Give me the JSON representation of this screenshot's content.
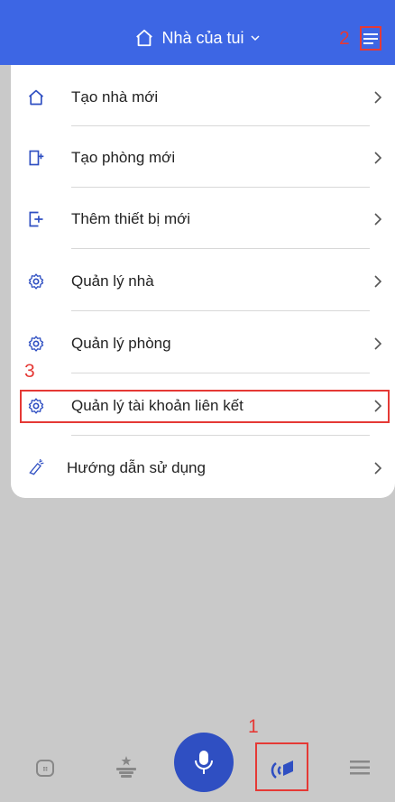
{
  "header": {
    "title": "Nhà của tui",
    "home_icon": "home-outline-icon",
    "dropdown_icon": "chevron-down-icon",
    "menu_icon": "hamburger-menu-icon",
    "color": "#3d66e4"
  },
  "menu": {
    "items": [
      {
        "label": "Tạo nhà mới",
        "icon": "home-outline-icon"
      },
      {
        "label": "Tạo phòng mới",
        "icon": "door-plus-icon"
      },
      {
        "label": "Thêm thiết bị mới",
        "icon": "device-plus-icon"
      },
      {
        "label": "Quản lý nhà",
        "icon": "gear-icon"
      },
      {
        "label": "Quản lý phòng",
        "icon": "gear-icon"
      },
      {
        "label": "Quản lý tài khoản liên kết",
        "icon": "gear-icon"
      },
      {
        "label": "Hướng dẫn sử dụng",
        "icon": "telescope-icon"
      }
    ]
  },
  "annotations": {
    "n1": "1",
    "n2": "2",
    "n3": "3",
    "color": "#e53935"
  },
  "bottom_nav": {
    "items": [
      {
        "icon": "home-grid-icon"
      },
      {
        "icon": "scene-star-icon"
      },
      {
        "icon": "microphone-icon"
      },
      {
        "icon": "remote-signal-icon"
      },
      {
        "icon": "menu-lines-icon"
      }
    ],
    "mic_color": "#2f4fc2"
  }
}
